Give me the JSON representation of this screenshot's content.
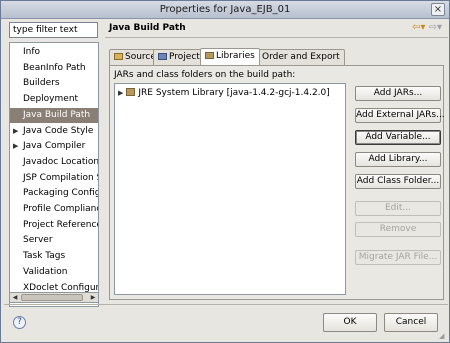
{
  "window": {
    "title": "Properties for Java_EJB_01",
    "close_label": "×"
  },
  "sidebar": {
    "filter_placeholder": "type filter text",
    "filter_value": "type filter text",
    "items": [
      {
        "label": "Info",
        "expandable": false,
        "selected": false
      },
      {
        "label": "BeanInfo Path",
        "expandable": false,
        "selected": false
      },
      {
        "label": "Builders",
        "expandable": false,
        "selected": false
      },
      {
        "label": "Deployment",
        "expandable": false,
        "selected": false
      },
      {
        "label": "Java Build Path",
        "expandable": false,
        "selected": true
      },
      {
        "label": "Java Code Style",
        "expandable": true,
        "selected": false
      },
      {
        "label": "Java Compiler",
        "expandable": true,
        "selected": false
      },
      {
        "label": "Javadoc Location",
        "expandable": false,
        "selected": false
      },
      {
        "label": "JSP Compilation Sup",
        "expandable": false,
        "selected": false
      },
      {
        "label": "Packaging Configura",
        "expandable": false,
        "selected": false
      },
      {
        "label": "Profile Compliance a",
        "expandable": false,
        "selected": false
      },
      {
        "label": "Project References",
        "expandable": false,
        "selected": false
      },
      {
        "label": "Server",
        "expandable": false,
        "selected": false
      },
      {
        "label": "Task Tags",
        "expandable": false,
        "selected": false
      },
      {
        "label": "Validation",
        "expandable": false,
        "selected": false
      },
      {
        "label": "XDoclet Configuratio",
        "expandable": false,
        "selected": false
      }
    ]
  },
  "page": {
    "title": "Java Build Path",
    "back_icon": "⇦▾",
    "forward_icon": "⇨▾"
  },
  "tabs": [
    {
      "label": "Source",
      "active": false,
      "icon": "source-folder-icon"
    },
    {
      "label": "Projects",
      "active": false,
      "icon": "projects-icon"
    },
    {
      "label": "Libraries",
      "active": true,
      "icon": "libraries-icon"
    },
    {
      "label": "Order and Export",
      "active": false,
      "icon": "order-export-icon"
    }
  ],
  "libraries": {
    "panel_label": "JARs and class folders on the build path:",
    "entries": [
      {
        "label": "JRE System Library [java-1.4.2-gcj-1.4.2.0]"
      }
    ]
  },
  "buttons": {
    "add_jars": "Add JARs...",
    "add_external_jars": "Add External JARs...",
    "add_variable": "Add Variable...",
    "add_library": "Add Library...",
    "add_class_folder": "Add Class Folder...",
    "edit": "Edit...",
    "remove": "Remove",
    "migrate_jar": "Migrate JAR File..."
  },
  "footer": {
    "help_glyph": "?",
    "ok": "OK",
    "cancel": "Cancel"
  },
  "colors": {
    "selection": "#8a7f74",
    "window_bg": "#e8e6e1",
    "accent_back": "#c88a1a"
  }
}
